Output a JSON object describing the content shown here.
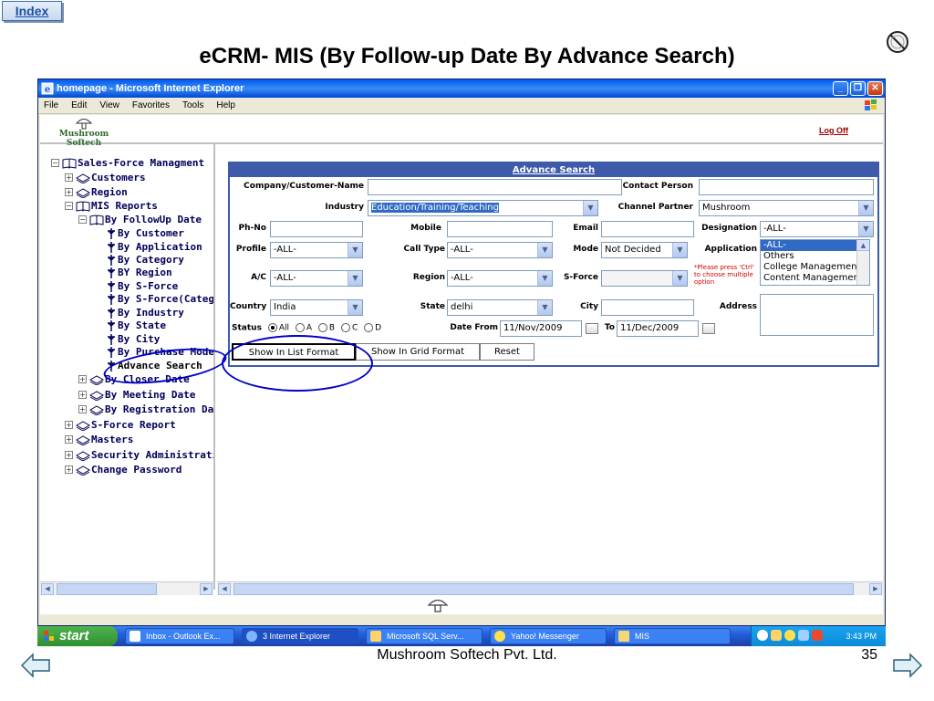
{
  "slide": {
    "index_label": "Index",
    "title": "eCRM- MIS (By Follow-up Date By Advance Search)",
    "footer_company": "Mushroom Softech Pvt. Ltd.",
    "page_number": "35"
  },
  "browser": {
    "title": "homepage - Microsoft Internet Explorer",
    "menu": [
      "File",
      "Edit",
      "View",
      "Favorites",
      "Tools",
      "Help"
    ]
  },
  "app": {
    "logo_text": "Mushroom Softech",
    "logoff_label": "Log Off"
  },
  "tree": {
    "root": "Sales-Force Managment",
    "customers": "Customers",
    "region": "Region",
    "mis_reports": "MIS Reports",
    "by_followup_date": "By FollowUp Date",
    "followup_children": [
      "By Customer",
      "By Application",
      "By Category",
      "BY Region",
      "By S-Force",
      "By S-Force(Category)",
      "By Industry",
      "By State",
      "By City",
      "By Purchase Mode",
      "Advance Search"
    ],
    "by_closer_date": "By Closer Date",
    "by_meeting_date": "By Meeting Date",
    "by_registration_date": "By Registration Date",
    "sforce_report": "S-Force Report",
    "masters": "Masters",
    "security_admin": "Security Administration",
    "change_password": "Change Password"
  },
  "search": {
    "title": "Advance Search",
    "labels": {
      "company": "Company/Customer-Name",
      "contact_person": "Contact Person",
      "industry": "Industry",
      "channel_partner": "Channel Partner",
      "phno": "Ph-No",
      "mobile": "Mobile",
      "email": "Email",
      "designation": "Designation",
      "profile": "Profile",
      "call_type": "Call Type",
      "mode": "Mode",
      "application": "Application",
      "ac": "A/C",
      "region": "Region",
      "sforce": "S-Force",
      "country": "Country",
      "state": "State",
      "city": "City",
      "address": "Address",
      "status": "Status",
      "date_from": "Date  From",
      "date_to": "To"
    },
    "values": {
      "company": "",
      "contact_person": "",
      "industry": "Education/Training/Teaching",
      "channel_partner": "Mushroom",
      "phno": "",
      "mobile": "",
      "email": "",
      "designation": "-ALL-",
      "profile": "-ALL-",
      "call_type": "-ALL-",
      "mode": "Not Decided",
      "ac": "-ALL-",
      "region": "-ALL-",
      "sforce": "",
      "country": "India",
      "state": "delhi",
      "city": "",
      "address": "",
      "date_from": "11/Nov/2009",
      "date_to": "11/Dec/2009"
    },
    "application_options": [
      "-ALL-",
      "Others",
      "College Management",
      "Content Management"
    ],
    "application_note": "*Please press 'Ctrl' to choose multiple option",
    "status_options": [
      "All",
      "A",
      "B",
      "C",
      "D"
    ],
    "status_selected": "All",
    "buttons": {
      "list": "Show In List Format",
      "grid": "Show In Grid Format",
      "reset": "Reset"
    }
  },
  "taskbar": {
    "start": "start",
    "items": [
      "Inbox - Outlook Ex...",
      "3 Internet Explorer",
      "Microsoft SQL Serv...",
      "Yahoo! Messenger",
      "MIS"
    ],
    "clock": "3:43 PM"
  },
  "colors": {
    "panel_header": "#3d5ba8",
    "annotation": "#0000c8",
    "tree_text": "#00005a"
  }
}
